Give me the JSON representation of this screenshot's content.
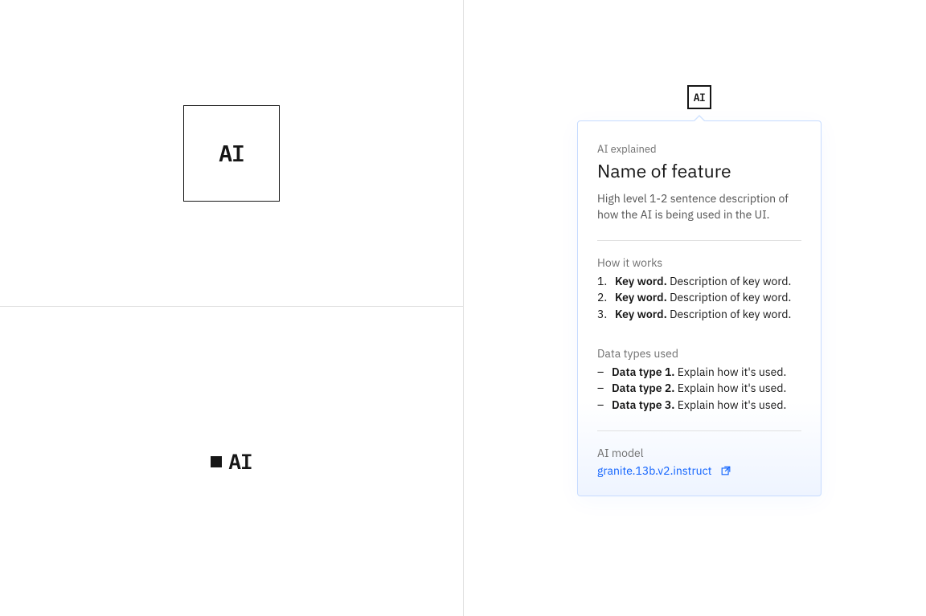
{
  "left_panel": {
    "ai_large_text": "AI",
    "ai_small_text": "AI"
  },
  "right_panel": {
    "chip_text": "AI",
    "popover": {
      "label": "AI explained",
      "title": "Name of feature",
      "description": "High level 1-2 sentence description of how the AI is being used in the UI.",
      "how_it_works_label": "How it works",
      "steps": [
        {
          "key": "Key word.",
          "desc": "Description of key word."
        },
        {
          "key": "Key word.",
          "desc": "Description of key word."
        },
        {
          "key": "Key word.",
          "desc": "Description of key word."
        }
      ],
      "data_types_label": "Data types used",
      "data_types": [
        {
          "name": "Data type 1.",
          "desc": "Explain how it's used."
        },
        {
          "name": "Data type 2.",
          "desc": "Explain how it's used."
        },
        {
          "name": "Data type 3.",
          "desc": "Explain how it's used."
        }
      ],
      "model_label": "AI model",
      "model_link_text": "granite.13b.v2.instruct"
    }
  }
}
